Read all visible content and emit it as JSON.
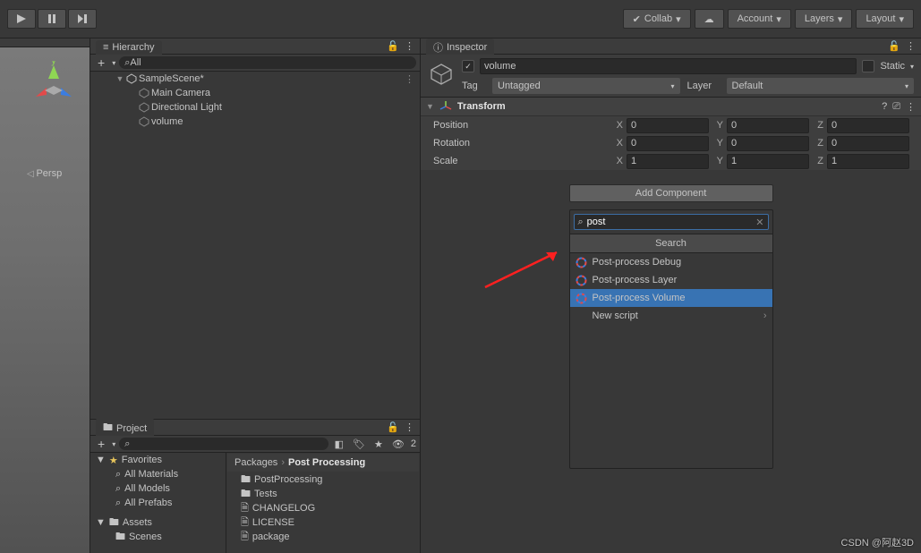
{
  "toolbar": {
    "collab": "Collab",
    "account": "Account",
    "layers": "Layers",
    "layout": "Layout"
  },
  "hierarchy": {
    "title": "Hierarchy",
    "search_label": "All",
    "scene": "SampleScene*",
    "items": [
      "Main Camera",
      "Directional Light",
      "volume"
    ]
  },
  "project": {
    "title": "Project",
    "favorites": "Favorites",
    "fav_items": [
      "All Materials",
      "All Models",
      "All Prefabs"
    ],
    "assets": "Assets",
    "asset_items": [
      "Scenes"
    ],
    "hidden_count": "2",
    "crumb1": "Packages",
    "crumb2": "Post Processing",
    "files": [
      {
        "name": "PostProcessing",
        "type": "folder"
      },
      {
        "name": "Tests",
        "type": "folder"
      },
      {
        "name": "CHANGELOG",
        "type": "file"
      },
      {
        "name": "LICENSE",
        "type": "file"
      },
      {
        "name": "package",
        "type": "file"
      }
    ]
  },
  "inspector": {
    "title": "Inspector",
    "name": "volume",
    "static": "Static",
    "tag_label": "Tag",
    "tag": "Untagged",
    "layer_label": "Layer",
    "layer": "Default",
    "transform": {
      "title": "Transform",
      "rows": [
        {
          "label": "Position",
          "x": "0",
          "y": "0",
          "z": "0"
        },
        {
          "label": "Rotation",
          "x": "0",
          "y": "0",
          "z": "0"
        },
        {
          "label": "Scale",
          "x": "1",
          "y": "1",
          "z": "1"
        }
      ]
    },
    "add_component": "Add Component",
    "popup": {
      "search": "post",
      "header": "Search",
      "items": [
        "Post-process Debug",
        "Post-process Layer",
        "Post-process Volume"
      ],
      "selected": 2,
      "new_script": "New script"
    }
  },
  "scene": {
    "persp": "Persp"
  },
  "watermark": "CSDN @阿赵3D"
}
